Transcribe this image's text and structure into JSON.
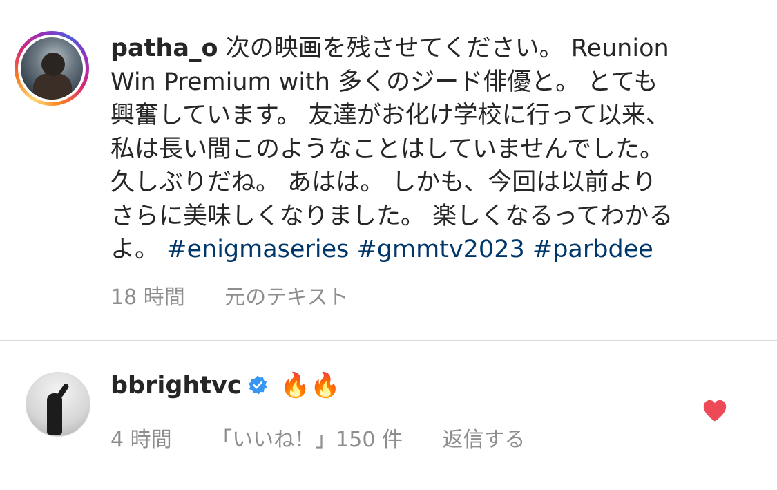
{
  "post": {
    "username": "patha_o",
    "caption_lines": [
      "次の映画を残させてください。 Reunion",
      "Win Premium with 多くのジード俳優と。 とても",
      "興奮しています。 友達がお化け学校に行って以来、",
      "私は長い間このようなことはしていませんでした。",
      "久しぶりだね。 あはは。 しかも、今回は以前より",
      "さらに美味しくなりました。 楽しくなるってわかる",
      "よ。"
    ],
    "hashtags": [
      "#enigmaseries",
      "#gmmtv2023",
      "#parbdee"
    ],
    "time": "18 時間",
    "see_original": "元のテキスト"
  },
  "comment": {
    "username": "bbrightvc",
    "text": "🔥🔥",
    "time": "4 時間",
    "likes": "「いいね！」150 件",
    "reply": "返信する"
  },
  "colors": {
    "hashtag": "#00376b",
    "verified": "#3897f0",
    "heart": "#ed4956",
    "meta": "#8e8e8e"
  },
  "icons": {
    "verified": "verified-badge-icon",
    "like": "heart-filled-icon"
  }
}
